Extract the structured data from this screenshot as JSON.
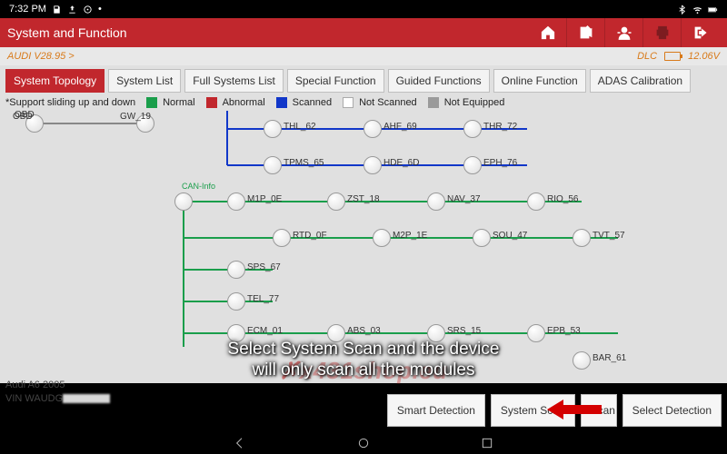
{
  "status": {
    "time": "7:32 PM"
  },
  "header": {
    "title": "System and Function"
  },
  "subheader": {
    "crumb": "AUDI V28.95 >",
    "dlc": "DLC",
    "voltage": "12.06V"
  },
  "tabs": [
    {
      "label": "System Topology",
      "active": true
    },
    {
      "label": "System List"
    },
    {
      "label": "Full Systems List"
    },
    {
      "label": "Special Function"
    },
    {
      "label": "Guided Functions"
    },
    {
      "label": "Online Function"
    },
    {
      "label": "ADAS Calibration"
    }
  ],
  "legend": {
    "note": "*Support sliding up and down",
    "items": [
      {
        "label": "Normal",
        "color": "#1a9e4b"
      },
      {
        "label": "Abnormal",
        "color": "#c1272d"
      },
      {
        "label": "Scanned",
        "color": "#1137c9"
      },
      {
        "label": "Not Scanned",
        "color": "#ffffff"
      },
      {
        "label": "Not Equipped",
        "color": "#9a9a9a"
      }
    ]
  },
  "bus_label": "CAN-Info",
  "nodes": {
    "obd": "OBD",
    "gw": "GW_19",
    "r1": [
      "THL_62",
      "AHF_69",
      "THR_72"
    ],
    "r2": [
      "TPMS_65",
      "HDE_6D",
      "EPH_76"
    ],
    "r3": [
      "M1P_0E",
      "ZST_18",
      "NAV_37",
      "RIO_56"
    ],
    "r4": [
      "RTD_0F",
      "M2P_1E",
      "SOU_47",
      "TVT_57"
    ],
    "r5": [
      "SPS_67"
    ],
    "r6": [
      "TEL_77"
    ],
    "r7": [
      "ECM_01",
      "ABS_03",
      "SRS_15",
      "EPB_53"
    ],
    "r8": [
      "BAR_61"
    ]
  },
  "vehicle": {
    "model": "Audi A6  2005",
    "vin_prefix": "VIN WAUDG"
  },
  "actions": {
    "smart": "Smart Detection",
    "system": "System Scan",
    "scan3": "Scan",
    "select": "Select Detection"
  },
  "caption": {
    "line1": "Select System Scan and the device",
    "line2": "will only scan all the modules"
  },
  "watermark": "x431shop.eu"
}
